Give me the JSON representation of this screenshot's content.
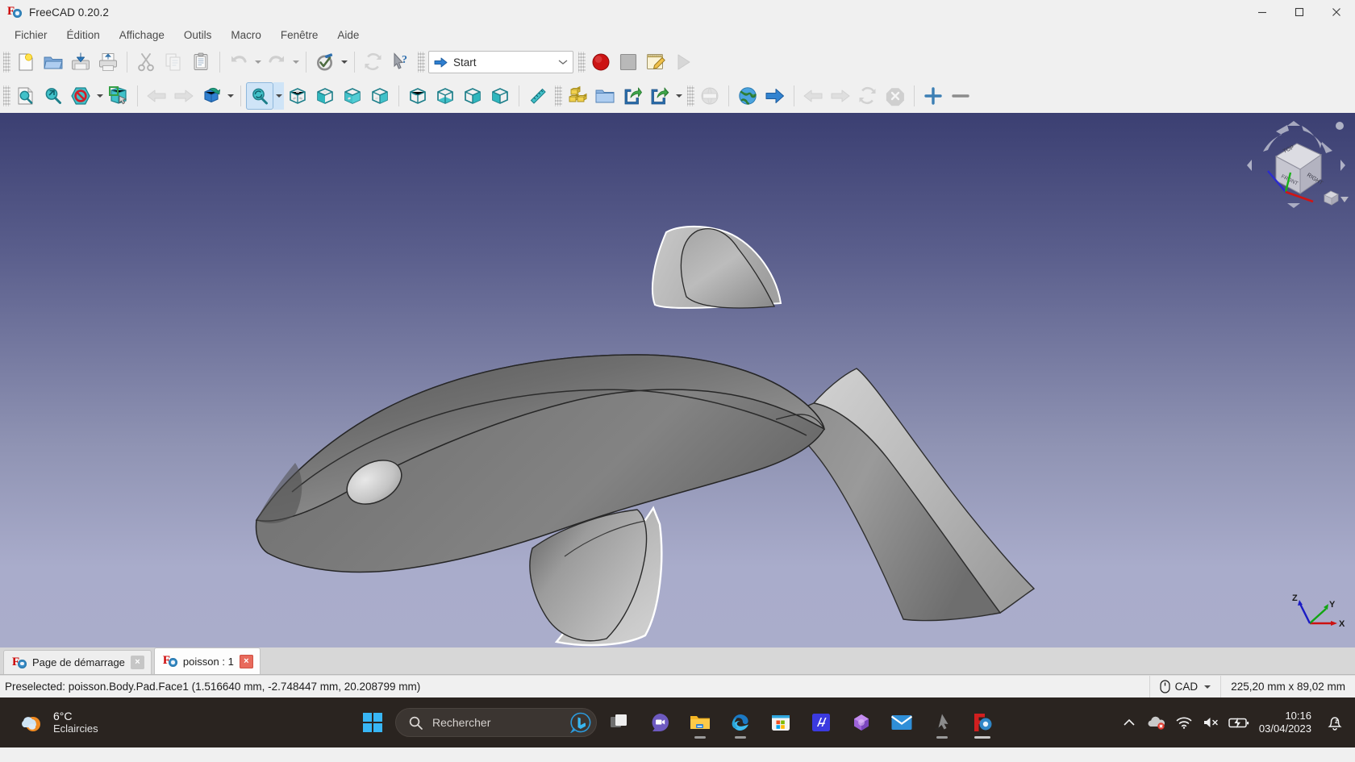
{
  "window": {
    "title": "FreeCAD 0.20.2",
    "minimize_label": "Minimize",
    "maximize_label": "Maximize",
    "close_label": "Close"
  },
  "menu": {
    "items": [
      {
        "label": "Fichier",
        "name": "menu-fichier"
      },
      {
        "label": "Édition",
        "name": "menu-edition"
      },
      {
        "label": "Affichage",
        "name": "menu-affichage"
      },
      {
        "label": "Outils",
        "name": "menu-outils"
      },
      {
        "label": "Macro",
        "name": "menu-macro"
      },
      {
        "label": "Fenêtre",
        "name": "menu-fenetre"
      },
      {
        "label": "Aide",
        "name": "menu-aide"
      }
    ]
  },
  "toolbar_file": {
    "buttons": [
      {
        "icon": "new-document-icon",
        "label": "Nouveau"
      },
      {
        "icon": "open-folder-icon",
        "label": "Ouvrir"
      },
      {
        "icon": "save-icon",
        "label": "Enregistrer"
      },
      {
        "icon": "print-icon",
        "label": "Imprimer"
      },
      {
        "icon": "cut-scissors-icon",
        "label": "Couper"
      },
      {
        "icon": "copy-icon",
        "label": "Copier"
      },
      {
        "icon": "paste-clipboard-icon",
        "label": "Coller"
      },
      {
        "icon": "undo-arrow-icon",
        "label": "Annuler"
      },
      {
        "icon": "redo-arrow-icon",
        "label": "Rétablir"
      },
      {
        "icon": "refresh-check-icon",
        "label": "Rafraîchir"
      },
      {
        "icon": "recompute-icon",
        "label": "Recalculer"
      },
      {
        "icon": "whats-this-cursor-icon",
        "label": "Qu'est-ce que c'est ?"
      }
    ]
  },
  "workbench": {
    "selected": "Start",
    "icon": "blue-arrow-icon",
    "chevron": "chevron-down-icon"
  },
  "toolbar_macro": {
    "buttons": [
      {
        "icon": "macro-record-icon",
        "label": "Enregistrer une macro"
      },
      {
        "icon": "macro-stop-icon",
        "label": "Arrêter l'enregistrement"
      },
      {
        "icon": "macro-edit-icon",
        "label": "Macros"
      },
      {
        "icon": "macro-execute-icon",
        "label": "Exécuter la macro"
      }
    ]
  },
  "toolbar_view": {
    "buttons": [
      {
        "icon": "fit-all-icon",
        "label": "Ajuster tout"
      },
      {
        "icon": "fit-selection-icon",
        "label": "Ajuster à la sélection"
      },
      {
        "icon": "draw-style-icon",
        "label": "Style de dessin"
      },
      {
        "icon": "box-selection-icon",
        "label": "Sélection par boîte"
      },
      {
        "icon": "prev-view-arrow-icon",
        "label": "Vue précédente"
      },
      {
        "icon": "next-view-arrow-icon",
        "label": "Vue suivante"
      },
      {
        "icon": "axonometric-icon",
        "label": "Axonométrique"
      },
      {
        "icon": "zoom-rotate-icon",
        "label": "Vue isométrique"
      },
      {
        "icon": "cube-front-icon",
        "label": "Vue de face"
      },
      {
        "icon": "cube-top-icon",
        "label": "Vue de dessus"
      },
      {
        "icon": "cube-right-icon",
        "label": "Vue de droite"
      },
      {
        "icon": "cube-rear-icon",
        "label": "Vue arrière"
      },
      {
        "icon": "cube-bottom-icon",
        "label": "Vue de dessous"
      },
      {
        "icon": "cube-left-icon",
        "label": "Vue de gauche"
      },
      {
        "icon": "measure-ruler-icon",
        "label": "Mesurer"
      },
      {
        "icon": "create-part-icon",
        "label": "Créer une pièce"
      },
      {
        "icon": "create-group-icon",
        "label": "Créer un groupe"
      },
      {
        "icon": "link-icon",
        "label": "Créer un lien"
      },
      {
        "icon": "link-group-icon",
        "label": "Créer un lien de groupe"
      },
      {
        "icon": "globe-dim-icon",
        "label": "Page de démarrage"
      },
      {
        "icon": "globe-icon",
        "label": "Naviguer"
      },
      {
        "icon": "go-arrow-icon",
        "label": "Aller"
      },
      {
        "icon": "back-arrow-icon",
        "label": "Précédent"
      },
      {
        "icon": "forward-arrow-icon",
        "label": "Suivant"
      },
      {
        "icon": "reload-icon",
        "label": "Recharger"
      },
      {
        "icon": "stop-loading-icon",
        "label": "Arrêter le chargement"
      },
      {
        "icon": "zoom-in-icon",
        "label": "Zoom avant"
      },
      {
        "icon": "zoom-out-icon",
        "label": "Zoom arrière"
      }
    ]
  },
  "view3d": {
    "navigation_cube_label": "Navigation cube",
    "axis_labels": {
      "x": "X",
      "y": "Y",
      "z": "Z"
    },
    "background_top": "#3b3f72",
    "background_bottom": "#aaadcb",
    "model_name": "poisson",
    "model_fill_light": "#b8b8b8",
    "model_fill_mid": "#8d8d8d",
    "model_fill_dark": "#6f6f6f"
  },
  "document_tabs": [
    {
      "label": "Page de démarrage",
      "name": "tab-page-de-demarrage",
      "selected": false,
      "close_label": "×"
    },
    {
      "label": "poisson : 1",
      "name": "tab-poisson",
      "selected": true,
      "close_label": "×"
    }
  ],
  "statusbar": {
    "message": "Preselected: poisson.Body.Pad.Face1 (1.516640 mm, -2.748447 mm, 20.208799 mm)",
    "navigation_mode": "CAD",
    "navigation_icon": "mouse-icon",
    "dimensions": "225,20 mm x 89,02 mm"
  },
  "taskbar": {
    "weather": {
      "temperature": "6°C",
      "description": "Eclaircies",
      "icon": "sun-cloud-icon"
    },
    "start_icon": "windows-start-icon",
    "search": {
      "placeholder": "Rechercher",
      "icon": "search-icon",
      "assistant_icon": "bing-chat-icon"
    },
    "apps": [
      {
        "icon": "task-view-icon",
        "label": "Affichage des tâches",
        "running": false
      },
      {
        "icon": "teams-chat-icon",
        "label": "Chat",
        "running": false
      },
      {
        "icon": "file-explorer-icon",
        "label": "Explorateur de fichiers",
        "running": true
      },
      {
        "icon": "edge-icon",
        "label": "Microsoft Edge",
        "running": true
      },
      {
        "icon": "microsoft-store-icon",
        "label": "Microsoft Store",
        "running": false
      },
      {
        "icon": "autodesk-icon",
        "label": "Autodesk",
        "running": false
      },
      {
        "icon": "office-icon",
        "label": "Microsoft 365",
        "running": false
      },
      {
        "icon": "mail-icon",
        "label": "Courrier",
        "running": false
      },
      {
        "icon": "inkscape-icon",
        "label": "Inkscape",
        "running": true
      },
      {
        "icon": "freecad-icon",
        "label": "FreeCAD",
        "running": true
      }
    ],
    "tray": {
      "overflow_icon": "chevron-up-icon",
      "onedrive_icon": "onedrive-error-icon",
      "wifi_icon": "wifi-icon",
      "volume_icon": "volume-muted-icon",
      "battery_icon": "battery-charging-icon",
      "time": "10:16",
      "date": "03/04/2023",
      "notification_icon": "notification-silent-icon"
    }
  }
}
